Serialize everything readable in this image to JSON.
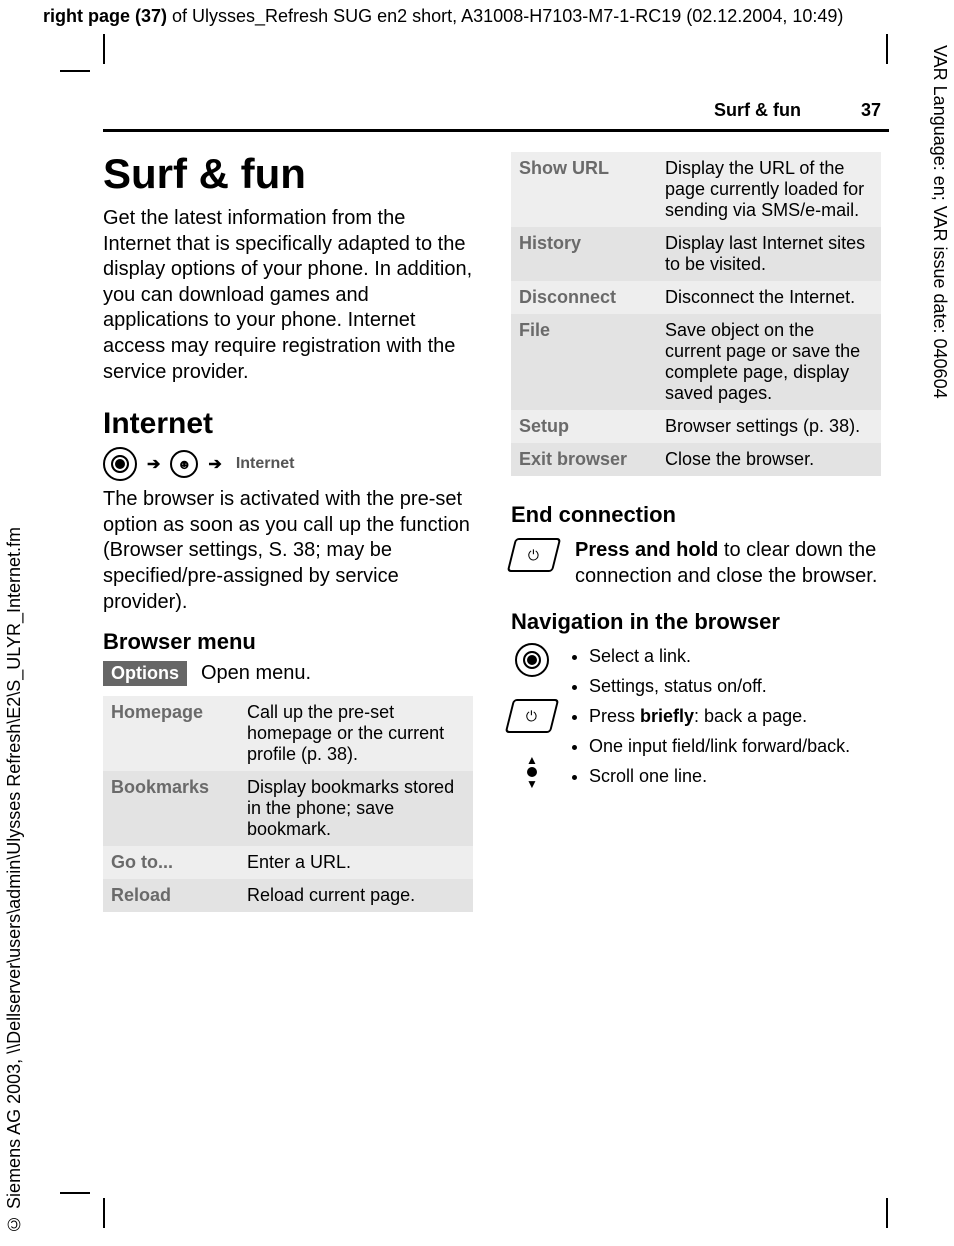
{
  "meta": {
    "top_header_bold": "right page (37)",
    "top_header_rest": " of Ulysses_Refresh SUG en2 short, A31008-H7103-M7-1-RC19 (02.12.2004, 10:49)",
    "right_vertical": "VAR Language: en; VAR issue date: 040604",
    "left_vertical": "© Siemens AG 2003, \\\\Dellserver\\users\\admin\\Ulysses Refresh\\E2\\S_ULYR_Internet.fm"
  },
  "running": {
    "section": "Surf & fun",
    "page": "37"
  },
  "left": {
    "title": "Surf & fun",
    "intro": "Get the latest information from the Internet that is specifically adapted to the display options of your phone. In addition, you can download games and applications to your phone. Internet access may require registration with the service provider.",
    "internet_heading": "Internet",
    "nav_label": "Internet",
    "internet_body": "The browser is activated with the pre-set option as soon as you call up the function (Browser settings, S. 38; may be specified/pre-assigned by service provider).",
    "browser_menu_heading": "Browser menu",
    "options_label": "Options",
    "options_text": "Open menu.",
    "menu": [
      {
        "k": "Homepage",
        "v": "Call up the pre-set homepage or the current profile (p. 38)."
      },
      {
        "k": "Bookmarks",
        "v": "Display bookmarks stored in the phone; save bookmark."
      },
      {
        "k": "Go to...",
        "v": "Enter a URL."
      },
      {
        "k": "Reload",
        "v": "Reload current page."
      }
    ]
  },
  "right": {
    "menu": [
      {
        "k": "Show URL",
        "v": "Display the URL of the page currently loaded for sending via SMS/e-mail."
      },
      {
        "k": "History",
        "v": "Display last Internet sites to be visited."
      },
      {
        "k": "Disconnect",
        "v": "Disconnect the Internet."
      },
      {
        "k": "File",
        "v": "Save object on the current page or save the complete page, display saved pages."
      },
      {
        "k": "Setup",
        "v": "Browser settings (p. 38)."
      },
      {
        "k": "Exit browser",
        "v": "Close the browser."
      }
    ],
    "end_heading": "End connection",
    "end_bold_lead": "Press and hold",
    "end_text_rest": " to clear down the connection and close the browser.",
    "nav_heading": "Navigation in the browser",
    "nav_items": {
      "a1": "Select a link.",
      "a2": "Settings, status on/off.",
      "b_pre": "Press ",
      "b_bold": "briefly",
      "b_post": ": back a page.",
      "c1": "One input field/link forward/back.",
      "c2": "Scroll one line."
    }
  }
}
